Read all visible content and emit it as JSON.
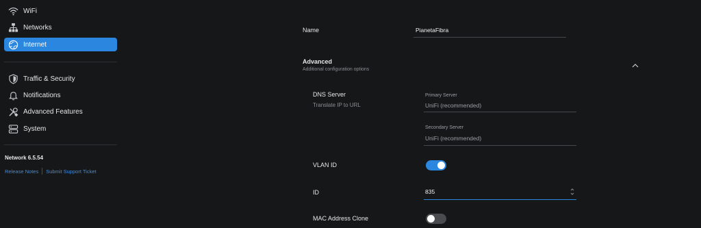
{
  "sidebar": {
    "items": [
      {
        "label": "WiFi",
        "icon": "wifi-icon"
      },
      {
        "label": "Networks",
        "icon": "networks-icon"
      },
      {
        "label": "Internet",
        "icon": "globe-icon",
        "active": true
      },
      {
        "label": "Traffic & Security",
        "icon": "shield-icon"
      },
      {
        "label": "Notifications",
        "icon": "bell-icon"
      },
      {
        "label": "Advanced Features",
        "icon": "tools-icon"
      },
      {
        "label": "System",
        "icon": "server-icon"
      }
    ],
    "version": "Network 6.5.54",
    "links": {
      "release_notes": "Release Notes",
      "support": "Submit Support Ticket"
    }
  },
  "form": {
    "name_label": "Name",
    "name_value": "PianetaFibra",
    "advanced_title": "Advanced",
    "advanced_subtitle": "Additional configuration options",
    "dns": {
      "label": "DNS Server",
      "sublabel": "Translate IP to URL",
      "primary_label": "Primary Server",
      "primary_value": "UniFi (recommended)",
      "secondary_label": "Secondary Server",
      "secondary_value": "UniFi (recommended)"
    },
    "vlan_label": "VLAN ID",
    "vlan_enabled": true,
    "id_label": "ID",
    "id_value": "835",
    "mac_label": "MAC Address Clone",
    "mac_enabled": false
  },
  "colors": {
    "accent": "#2b86e0",
    "background": "#161718",
    "divider": "#2f3033"
  }
}
